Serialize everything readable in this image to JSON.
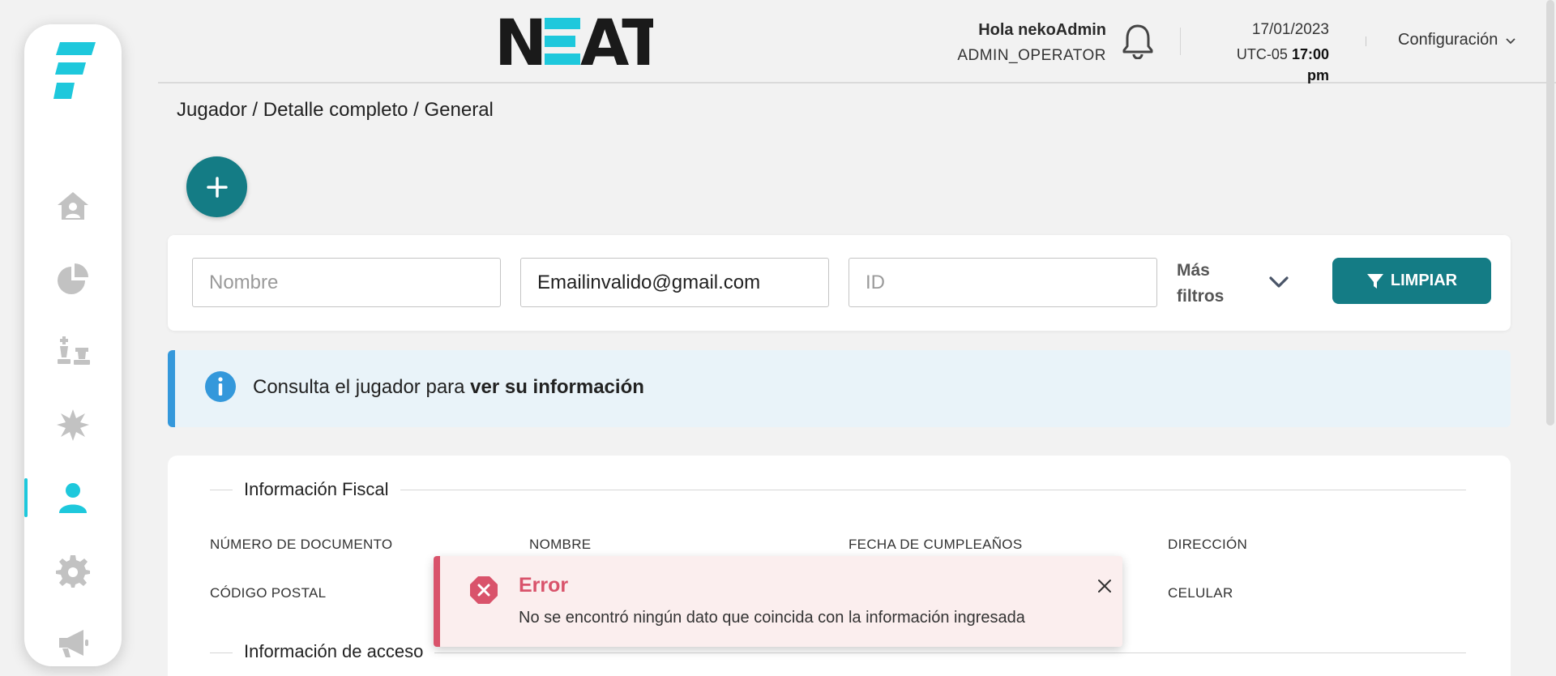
{
  "header": {
    "brand": "NEAT",
    "greeting": "Hola nekoAdmin",
    "role": "ADMIN_OPERATOR",
    "date": "17/01/2023",
    "timezone": "UTC-05",
    "time": "17:00 pm",
    "config_label": "Configuración"
  },
  "sidebar": {
    "items": [
      {
        "icon": "home-icon"
      },
      {
        "icon": "pie-chart-icon"
      },
      {
        "icon": "chess-icon"
      },
      {
        "icon": "starburst-icon"
      },
      {
        "icon": "user-icon",
        "active": true
      },
      {
        "icon": "gear-icon"
      },
      {
        "icon": "megaphone-icon"
      }
    ]
  },
  "breadcrumb": "Jugador / Detalle completo / General",
  "filters": {
    "name_placeholder": "Nombre",
    "email_value": "Emailinvalido@gmail.com",
    "id_placeholder": "ID",
    "more_filters_line1": "Más",
    "more_filters_line2": "filtros",
    "clear_button": "LIMPIAR"
  },
  "info_alert": {
    "text": "Consulta el jugador para ",
    "bold": "ver su información"
  },
  "fiscal": {
    "title": "Información Fiscal",
    "labels": [
      "NÚMERO DE DOCUMENTO",
      "NOMBRE",
      "FECHA DE CUMPLEAÑOS",
      "DIRECCIÓN",
      "CÓDIGO POSTAL",
      "CELULAR"
    ]
  },
  "access": {
    "title": "Información de acceso"
  },
  "toast": {
    "title": "Error",
    "message": "No se encontró ningún dato que coincida con la información ingresada"
  },
  "colors": {
    "primary": "#147c85",
    "accent": "#1ec8dc",
    "error": "#d9536b",
    "info": "#3498db"
  }
}
